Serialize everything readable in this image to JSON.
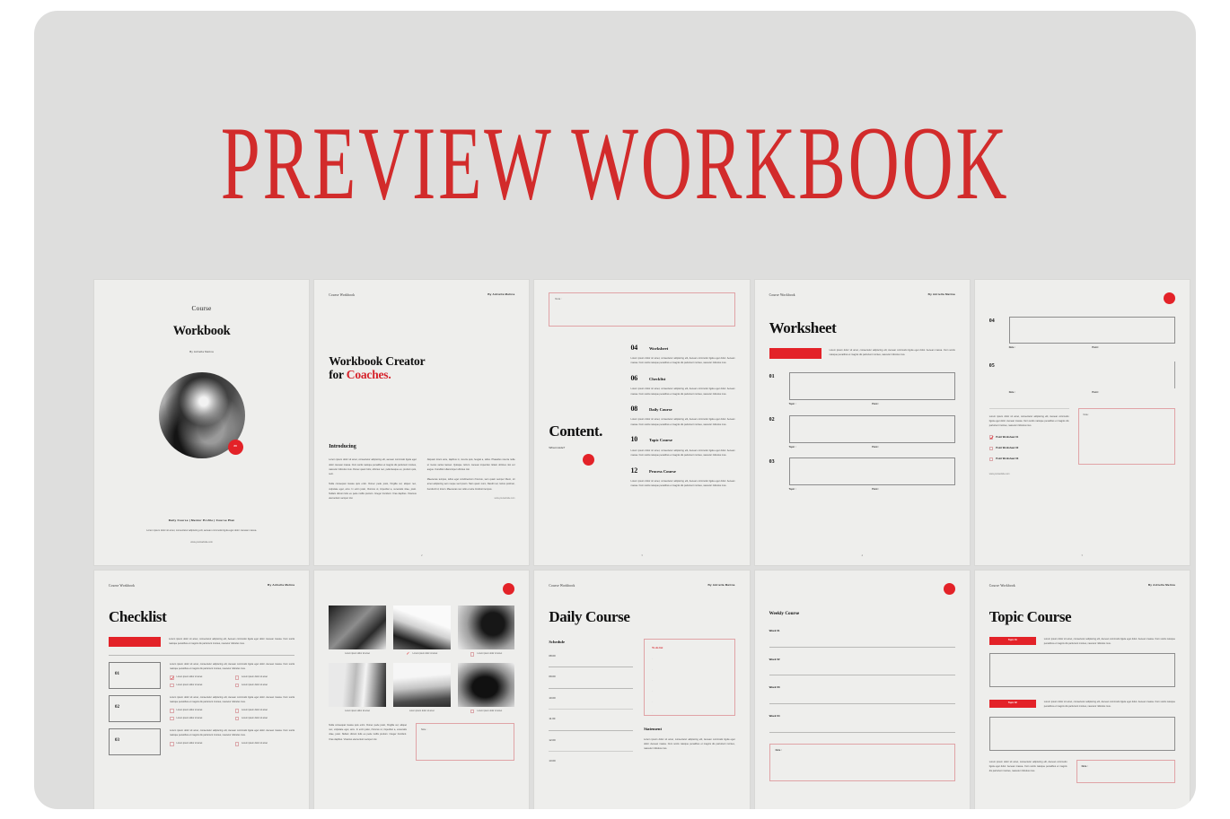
{
  "hero": {
    "title": "PREVIEW WORKBOOK",
    "accent": "#d22b2b"
  },
  "theme": {
    "canvas_bg": "#dededd",
    "slide_bg": "#eeeeec",
    "red": "#e32228"
  },
  "common": {
    "header_left": "Course Workbook",
    "header_right": "By Adriella Melina",
    "lorem_short": "Lorem ipsum dolor sit amet, consectetur adipiscing elit, Aenean commodo ligula eget dolor. Aenean massa. Cum sociis natoque penatibus et magnis dis parturient montes, nascetur ridiculus mus.",
    "lorem_a": "Lorem ipsum dolor sit amet, consectetur adipiscing elit, aenean commodo ligula eget dolor. Aenean massa. Cum sociis natoque penatibus et magnis dis parturient montes, nascetur ridiculus mus. Donec quam felis, ultricies nec, pellentesque eu, pretium quis, sem.",
    "lorem_b": "Nulla consequat massa quis enim. Donec pede justo, fringilla vel, aliquet nec, vulputate eget, arcu. In enim justo, rhoncus ut, imperdiet a, venenatis vitae, justo. Nullam dictum felis eu pede mollis pretium. Integer tincidunt. Cras dapibus. Vivamus elementum semper nisi.",
    "lorem_c": "Aliquam lorem ante, dapibus in, viverra quis, feugiat a, tellus. Phasellus viverra nulla ut metus varius laoreet. Quisque rutrum. Aenean imperdiet. Etiam ultricies nisi vel augue. Curabitur ullamcorper ultricies nisi.",
    "lorem_d": "Maecenas tempus, tellus eget condimentum rhoncus, sem quam semper libero, sit amet adipiscing sem neque sed ipsum. Nam quam nunc, blandit vel, luctus pulvinar, hendrerit id, lorem. Maecenas nec odio et ante tincidunt tempus.",
    "note_label": "Note :",
    "topic_label": "Topic :",
    "point_label": "Point :",
    "url": "www.yourwebsite.com"
  },
  "slides": [
    {
      "id": "cover",
      "name": "cover-slide",
      "eyebrow": "Course",
      "title": "Workbook",
      "byline": "By Adriella Melina",
      "badge": "20",
      "nav": "Daily Course  |   Mentor Profile  |  Course Plan",
      "subtitle": "Lorem ipsum dolor sit amet, consectetur adipiscing elit, aenean commodo ligula eget dolor. Aenean massa.",
      "url": "www.yourwebsite.com"
    },
    {
      "id": "intro",
      "name": "intro-slide",
      "title_line1": "Workbook Creator",
      "title_line2_plain": "for ",
      "title_line2_accent": "Coaches.",
      "section": "Introducing",
      "page": "2"
    },
    {
      "id": "content",
      "name": "content-slide",
      "note_label": "Note :",
      "title": "Content.",
      "subtitle": "What inside?",
      "items": [
        {
          "num": "04",
          "label": "Worksheet"
        },
        {
          "num": "06",
          "label": "Checklist"
        },
        {
          "num": "08",
          "label": "Daily Course"
        },
        {
          "num": "10",
          "label": "Topic Course"
        },
        {
          "num": "12",
          "label": "Process Course"
        }
      ],
      "page": "3"
    },
    {
      "id": "worksheet",
      "name": "worksheet-slide",
      "title": "Worksheet",
      "rows": [
        "01",
        "02",
        "03"
      ],
      "page": "4"
    },
    {
      "id": "worksheet2",
      "name": "worksheet-continued-slide",
      "rows": [
        "04",
        "05"
      ],
      "checkboxes": [
        {
          "label": "Point Worksheet 01",
          "checked": true
        },
        {
          "label": "Point Worksheet 02",
          "checked": false
        },
        {
          "label": "Point Worksheet 03",
          "checked": false
        }
      ],
      "url": "www.yourwebsite.com",
      "page": "5"
    },
    {
      "id": "checklist",
      "name": "checklist-slide",
      "title": "Checklist",
      "rows": [
        {
          "num": "01",
          "items": [
            "Lorem ipsum dolor sit amet",
            "Lorem ipsum dolor sit amet",
            "Lorem ipsum dolor sit amet",
            "Lorem ipsum dolor sit amet"
          ],
          "first_checked": true
        },
        {
          "num": "02",
          "items": [
            "Lorem ipsum dolor sit amet",
            "Lorem ipsum dolor sit amet",
            "Lorem ipsum dolor sit amet",
            "Lorem ipsum dolor sit amet"
          ],
          "first_checked": false
        },
        {
          "num": "03",
          "items": [
            "Lorem ipsum dolor sit amet",
            "Lorem ipsum dolor sit amet"
          ],
          "first_checked": false
        }
      ]
    },
    {
      "id": "gallery",
      "name": "gallery-slide",
      "captions": [
        {
          "text": "Lorem ipsum dolor sit amet",
          "check": "none"
        },
        {
          "text": "Lorem ipsum dolor sit amet",
          "check": "checked"
        },
        {
          "text": "Lorem ipsum dolor sit amet",
          "check": "box"
        },
        {
          "text": "Lorem ipsum dolor sit amet",
          "check": "none"
        },
        {
          "text": "Lorem ipsum dolor sit amet",
          "check": "none"
        },
        {
          "text": "Lorem ipsum dolor sit amet",
          "check": "box"
        }
      ],
      "note_label": "Note :"
    },
    {
      "id": "daily",
      "name": "daily-course-slide",
      "title": "Daily Course",
      "schedule_label": "Schedule",
      "times": [
        "08.00",
        "09.00",
        "10.00",
        "11.00",
        "12.00",
        "13.00"
      ],
      "todo_label": "To do list",
      "statement_label": "Statement"
    },
    {
      "id": "weekly",
      "name": "weekly-course-slide",
      "title": "Weekly Course",
      "weeks": [
        "Week 01",
        "Week 02",
        "Week 03",
        "Week 04"
      ],
      "note_label": "Note :"
    },
    {
      "id": "topic",
      "name": "topic-course-slide",
      "title": "Topic Course",
      "badges": [
        "Topic 01",
        "Topic 02"
      ],
      "note_label": "Note :"
    }
  ]
}
